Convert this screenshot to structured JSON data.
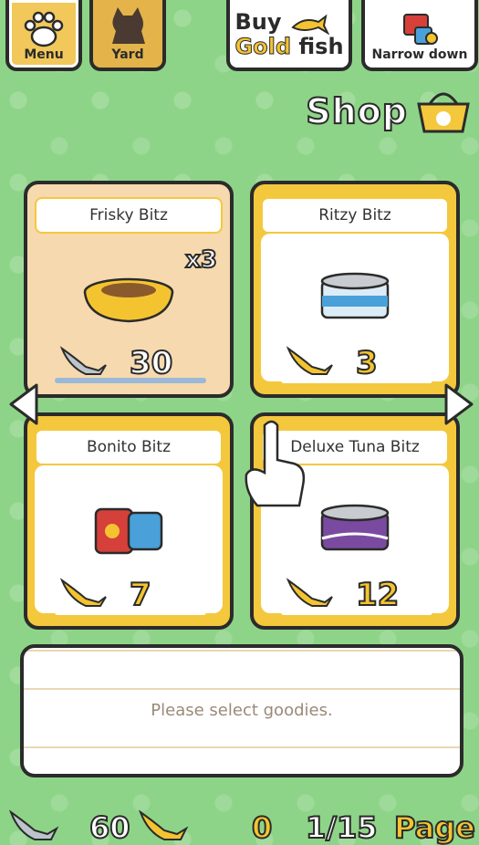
{
  "nav": {
    "menu_label": "Menu",
    "yard_label": "Yard",
    "buy_line1": "Buy",
    "buy_gold": "Gold",
    "buy_fish": "fish",
    "narrow_label": "Narrow down"
  },
  "title": "Shop",
  "items": [
    {
      "name": "Frisky Bitz",
      "price": "30",
      "currency": "silver",
      "qty": "x3",
      "selected": true
    },
    {
      "name": "Ritzy Bitz",
      "price": "3",
      "currency": "gold",
      "selected": false
    },
    {
      "name": "Bonito Bitz",
      "price": "7",
      "currency": "gold",
      "selected": false
    },
    {
      "name": "Deluxe Tuna Bitz",
      "price": "12",
      "currency": "gold",
      "selected": false
    }
  ],
  "description": "Please select goodies.",
  "footer": {
    "silver_fish": "60",
    "gold_fish": "0",
    "page": "1/15",
    "page_label": "Page"
  },
  "colors": {
    "background": "#8ed488",
    "accent": "#f4c83d",
    "gold": "#f4c430"
  }
}
